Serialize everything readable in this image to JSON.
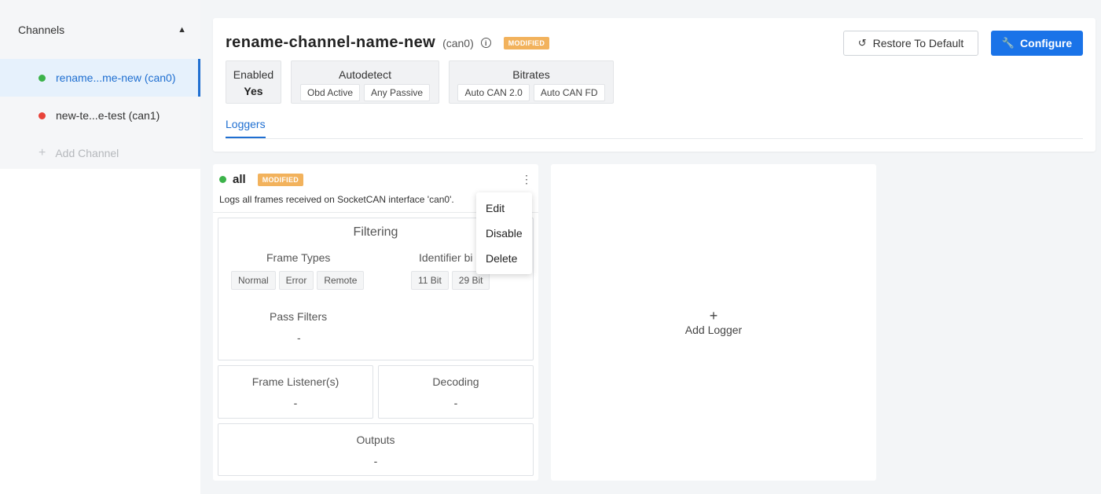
{
  "sidebar": {
    "header": "Channels",
    "items": [
      {
        "label": "rename...me-new (can0)",
        "status": "green"
      },
      {
        "label": "new-te...e-test (can1)",
        "status": "red"
      }
    ],
    "add_label": "Add Channel"
  },
  "channel": {
    "title": "rename-channel-name-new",
    "interface": "(can0)",
    "badge": "MODIFIED",
    "restore_label": "Restore To Default",
    "configure_label": "Configure",
    "enabled_label": "Enabled",
    "enabled_value": "Yes",
    "autodetect_label": "Autodetect",
    "autodetect_chips": [
      "Obd Active",
      "Any Passive"
    ],
    "bitrates_label": "Bitrates",
    "bitrates_chips": [
      "Auto CAN 2.0",
      "Auto CAN FD"
    ],
    "tab": "Loggers"
  },
  "logger": {
    "name": "all",
    "badge": "MODIFIED",
    "description": "Logs all frames received on SocketCAN interface 'can0'.",
    "filtering_title": "Filtering",
    "frame_types_label": "Frame Types",
    "frame_types": [
      "Normal",
      "Error",
      "Remote"
    ],
    "identifier_label": "Identifier bi",
    "identifier_bits": [
      "11 Bit",
      "29 Bit"
    ],
    "pass_filters_label": "Pass Filters",
    "pass_filters_value": "-",
    "frame_listeners_label": "Frame Listener(s)",
    "frame_listeners_value": "-",
    "decoding_label": "Decoding",
    "decoding_value": "-",
    "outputs_label": "Outputs",
    "outputs_value": "-"
  },
  "menu": {
    "items": [
      "Edit",
      "Disable",
      "Delete"
    ]
  },
  "add_logger": {
    "plus": "+",
    "label": "Add Logger"
  },
  "colors": {
    "accent": "#1a73e8",
    "badge": "#f2b25c",
    "status_green": "#3cb34a",
    "status_red": "#e8433a"
  },
  "icons": [
    "chevron-up-icon",
    "info-icon",
    "restore-icon",
    "wrench-icon",
    "kebab-icon",
    "plus-icon"
  ]
}
